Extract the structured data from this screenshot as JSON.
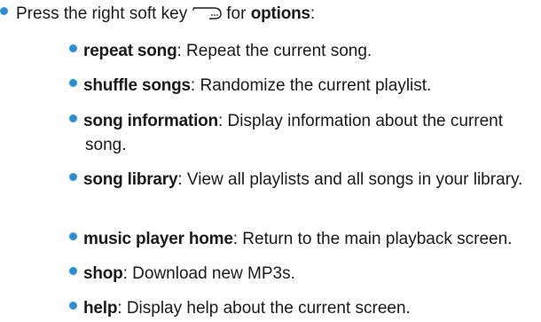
{
  "intro": {
    "prefix": "Press the right soft key",
    "middle": "for",
    "bold": "options",
    "suffix": ":"
  },
  "options": [
    {
      "term": "repeat song",
      "desc": ": Repeat the current song."
    },
    {
      "term": "shuffle songs",
      "desc": ": Randomize the current playlist."
    },
    {
      "term": "song information",
      "desc": ": Display information about the current song."
    },
    {
      "term": "song library",
      "desc": ": View all playlists and all songs in your library."
    },
    {
      "term": "music player home",
      "desc": ": Return to the main playback screen."
    },
    {
      "term": "shop",
      "desc": ": Download new MP3s."
    },
    {
      "term": "help",
      "desc": ": Display help about the current screen."
    }
  ],
  "colors": {
    "bullet": "#2b8fd6",
    "text": "#1a1a1a"
  },
  "icons": {
    "soft_key": "right-soft-key-icon"
  }
}
